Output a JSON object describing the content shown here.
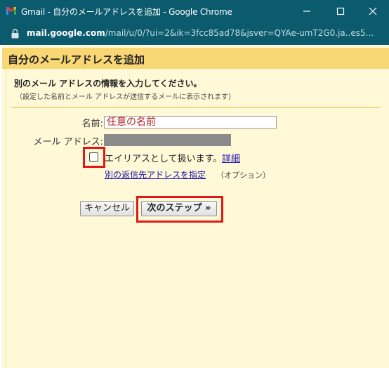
{
  "window": {
    "title": "Gmail - 自分のメールアドレスを追加 - Google Chrome",
    "url_host": "mail.google.com",
    "url_path": "/mail/u/0/?ui=2&ik=3fcc85ad78&jsver=QYAe-umT2G0.ja..es5..."
  },
  "dialog": {
    "header": "自分のメールアドレスを追加",
    "intro_title": "別のメール アドレスの情報を入力してください。",
    "intro_sub": "（設定した名前とメール アドレスが送信するメールに表示されます）",
    "name_label": "名前:",
    "name_value": "任意の名前",
    "address_label": "メール アドレス:",
    "alias_label": "エイリアスとして扱います。",
    "alias_checked": false,
    "detail_link": "詳細",
    "reply_to_link": "別の返信先アドレスを指定",
    "optional_note": "（オプション）",
    "cancel_button": "キャンセル",
    "next_button": "次のステップ »"
  },
  "colors": {
    "title_bar": "#0b5a6e",
    "header_bar": "#f9d774",
    "background": "#fff9d8",
    "highlight": "#e01818",
    "link": "#1a0dab",
    "name_text": "#b22222"
  }
}
